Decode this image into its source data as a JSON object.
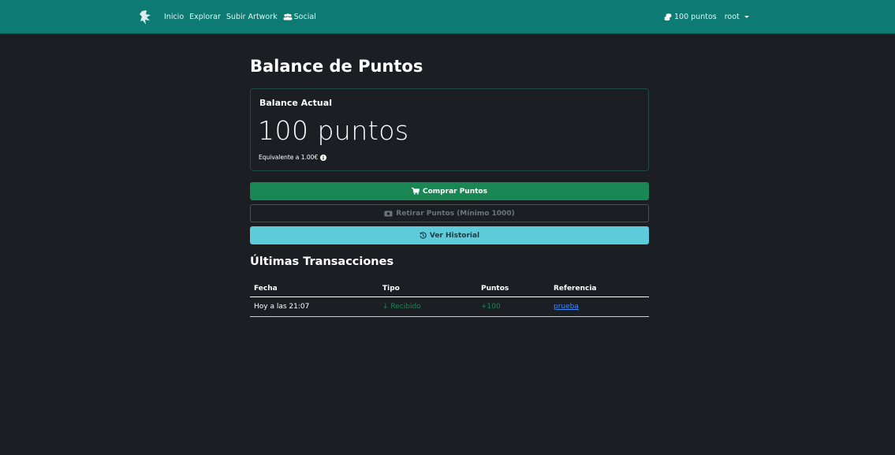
{
  "navbar": {
    "brand_icon": "logo-icon",
    "links": [
      "Inicio",
      "Explorar",
      "Subir Artwork"
    ],
    "social_label": "Social",
    "points_label": "100 puntos",
    "user_label": "root",
    "accent_color": "#0d7a73"
  },
  "page": {
    "title": "Balance de Puntos"
  },
  "balance": {
    "label": "Balance Actual",
    "amount": "100 puntos",
    "equivalent": "Equivalente a 1.00€"
  },
  "actions": {
    "buy_label": "Comprar Puntos",
    "withdraw_label": "Retirar Puntos (Mínimo 1000)",
    "history_label": "Ver Historial"
  },
  "transactions": {
    "title": "Últimas Transacciones",
    "headers": [
      "Fecha",
      "Tipo",
      "Puntos",
      "Referencia"
    ],
    "rows": [
      {
        "fecha": "Hoy a las 21:07",
        "tipo": "Recibido",
        "puntos": "+100",
        "referencia": "prueba"
      }
    ]
  }
}
